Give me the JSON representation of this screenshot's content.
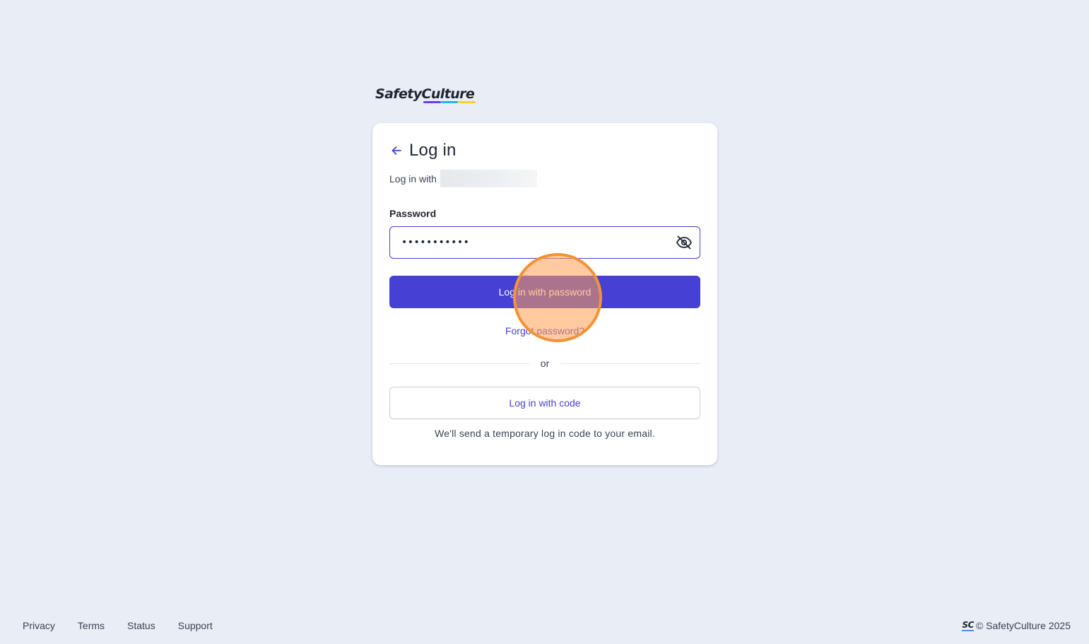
{
  "brand": {
    "name": "SafetyCulture",
    "bar_colors": [
      "#6a3df0",
      "#23b6e6",
      "#ffd028"
    ]
  },
  "login": {
    "title": "Log in",
    "subtitle_prefix": "Log in with",
    "password_label": "Password",
    "password_value": "•••••••••••",
    "primary_button": "Log in with password",
    "forgot_link": "Forgot password?",
    "divider_text": "or",
    "code_button": "Log in with code",
    "code_hint": "We'll send a temporary log in code to your email."
  },
  "icons": {
    "back": "arrow-left-icon",
    "toggle_visibility": "eye-off-icon",
    "footer_mark": "safetyculture-mark-icon"
  },
  "footer": {
    "links": [
      "Privacy",
      "Terms",
      "Status",
      "Support"
    ],
    "sc_mark": "SC",
    "copyright": "© SafetyCulture 2025"
  },
  "colors": {
    "accent": "#4740d4",
    "background": "#e9edf5",
    "cursor_highlight": "#f39236"
  }
}
